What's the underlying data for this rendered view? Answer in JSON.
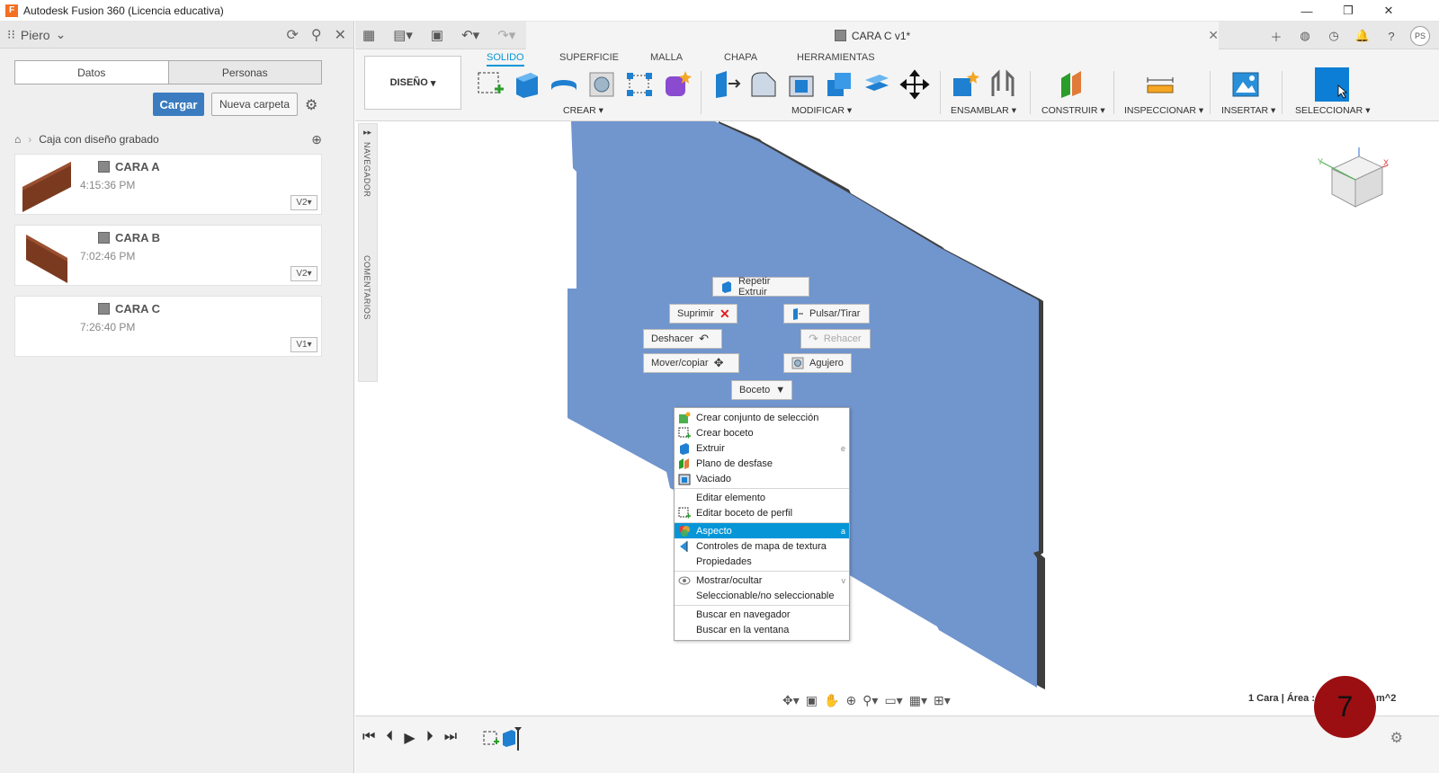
{
  "window": {
    "title": "Autodesk Fusion 360 (Licencia educativa)",
    "minimize": "—",
    "restore": "❐",
    "close": "✕"
  },
  "data_panel": {
    "user": "Piero",
    "tabs": [
      "Datos",
      "Personas"
    ],
    "upload_button": "Cargar",
    "new_folder_button": "Nueva carpeta",
    "breadcrumb": "Caja con diseño grabado",
    "files": [
      {
        "name": "CARA A",
        "time": "4:15:36 PM",
        "version": "V2"
      },
      {
        "name": "CARA B",
        "time": "7:02:46 PM",
        "version": "V2"
      },
      {
        "name": "CARA C",
        "time": "7:26:40 PM",
        "version": "V1"
      }
    ]
  },
  "document_tab": {
    "title": "CARA C v1*"
  },
  "user_initials": "PS",
  "ribbon": {
    "workspace": "DISEÑO",
    "tabs": [
      "SOLIDO",
      "SUPERFICIE",
      "MALLA",
      "CHAPA",
      "HERRAMIENTAS"
    ],
    "groups": [
      "CREAR",
      "MODIFICAR",
      "ENSAMBLAR",
      "CONSTRUIR",
      "INSPECCIONAR",
      "INSERTAR",
      "SELECCIONAR"
    ]
  },
  "browser_strip": {
    "navigator": "NAVEGADOR",
    "comments": "COMENTARIOS"
  },
  "marking_menu": {
    "repeat": "Repetir Extruir",
    "suppress": "Suprimir",
    "press_pull": "Pulsar/Tirar",
    "undo": "Deshacer",
    "redo": "Rehacer",
    "move_copy": "Mover/copiar",
    "hole": "Agujero",
    "sketch": "Boceto"
  },
  "context_menu": {
    "items": [
      {
        "label": "Crear conjunto de selección",
        "shortcut": ""
      },
      {
        "label": "Crear boceto",
        "shortcut": ""
      },
      {
        "label": "Extruir",
        "shortcut": "e"
      },
      {
        "label": "Plano de desfase",
        "shortcut": ""
      },
      {
        "label": "Vaciado",
        "shortcut": ""
      },
      {
        "label": "Editar elemento",
        "shortcut": ""
      },
      {
        "label": "Editar boceto de perfil",
        "shortcut": ""
      },
      {
        "label": "Aspecto",
        "shortcut": "a"
      },
      {
        "label": "Controles de mapa de textura",
        "shortcut": ""
      },
      {
        "label": "Propiedades",
        "shortcut": ""
      },
      {
        "label": "Mostrar/ocultar",
        "shortcut": "v"
      },
      {
        "label": "Seleccionable/no seleccionable",
        "shortcut": ""
      },
      {
        "label": "Buscar en navegador",
        "shortcut": ""
      },
      {
        "label": "Buscar en la ventana",
        "shortcut": ""
      }
    ],
    "highlighted": "Aspecto"
  },
  "status": {
    "left": "1 Cara | Área :",
    "right": "m^2"
  },
  "step_badge": "7",
  "colors": {
    "accent": "#0696d7",
    "panel": "#6f93c8",
    "edge": "#444444",
    "badge": "#9b0f12"
  }
}
